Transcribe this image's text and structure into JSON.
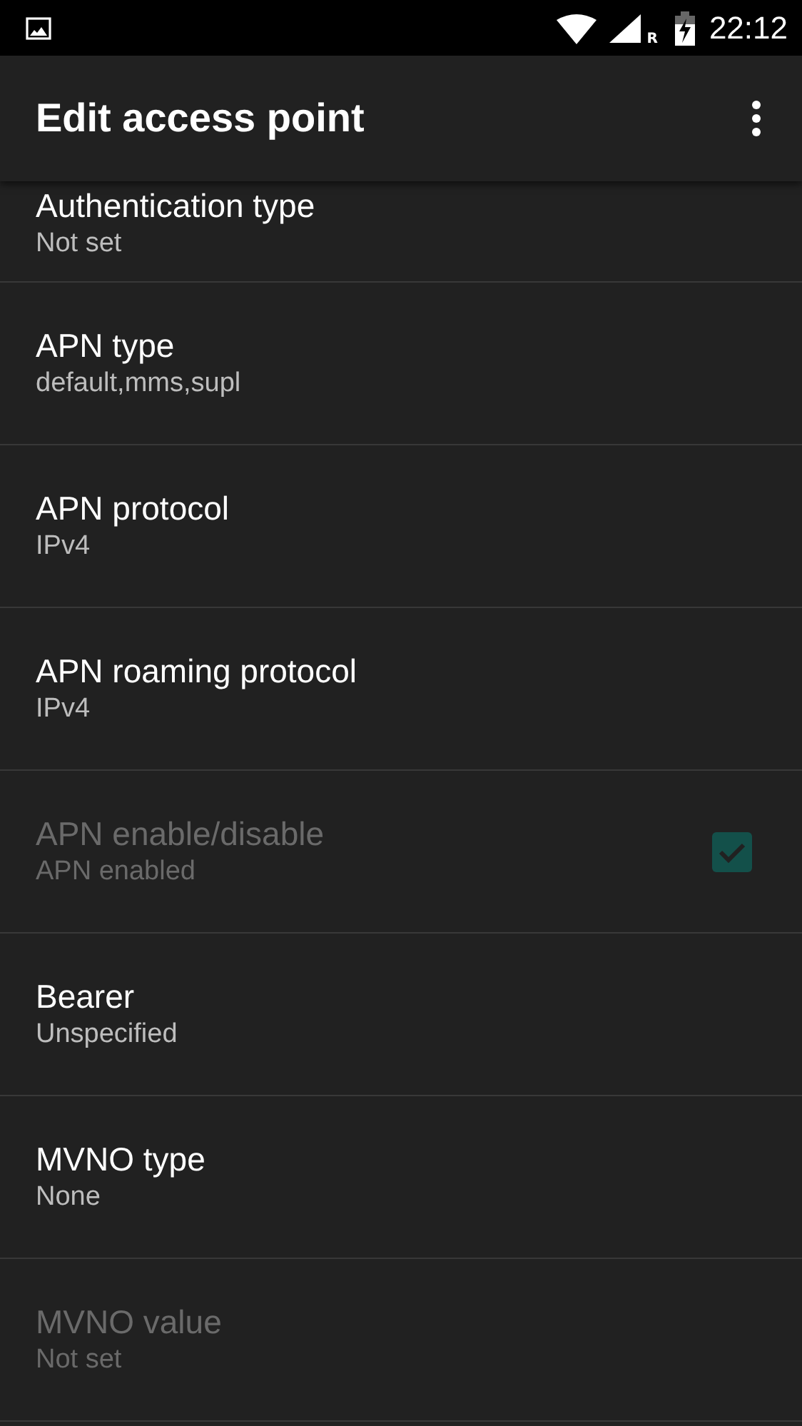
{
  "status_bar": {
    "roaming": "R",
    "time": "22:12"
  },
  "toolbar": {
    "title": "Edit access point"
  },
  "preferences": [
    {
      "kind": "text",
      "title": "Authentication type",
      "summary": "Not set",
      "disabled": false
    },
    {
      "kind": "text",
      "title": "APN type",
      "summary": "default,mms,supl",
      "disabled": false
    },
    {
      "kind": "text",
      "title": "APN protocol",
      "summary": "IPv4",
      "disabled": false
    },
    {
      "kind": "text",
      "title": "APN roaming protocol",
      "summary": "IPv4",
      "disabled": false
    },
    {
      "kind": "checkbox",
      "title": "APN enable/disable",
      "summary": "APN enabled",
      "disabled": true,
      "checked": true
    },
    {
      "kind": "text",
      "title": "Bearer",
      "summary": "Unspecified",
      "disabled": false
    },
    {
      "kind": "text",
      "title": "MVNO type",
      "summary": "None",
      "disabled": false
    },
    {
      "kind": "text",
      "title": "MVNO value",
      "summary": "Not set",
      "disabled": true
    }
  ]
}
